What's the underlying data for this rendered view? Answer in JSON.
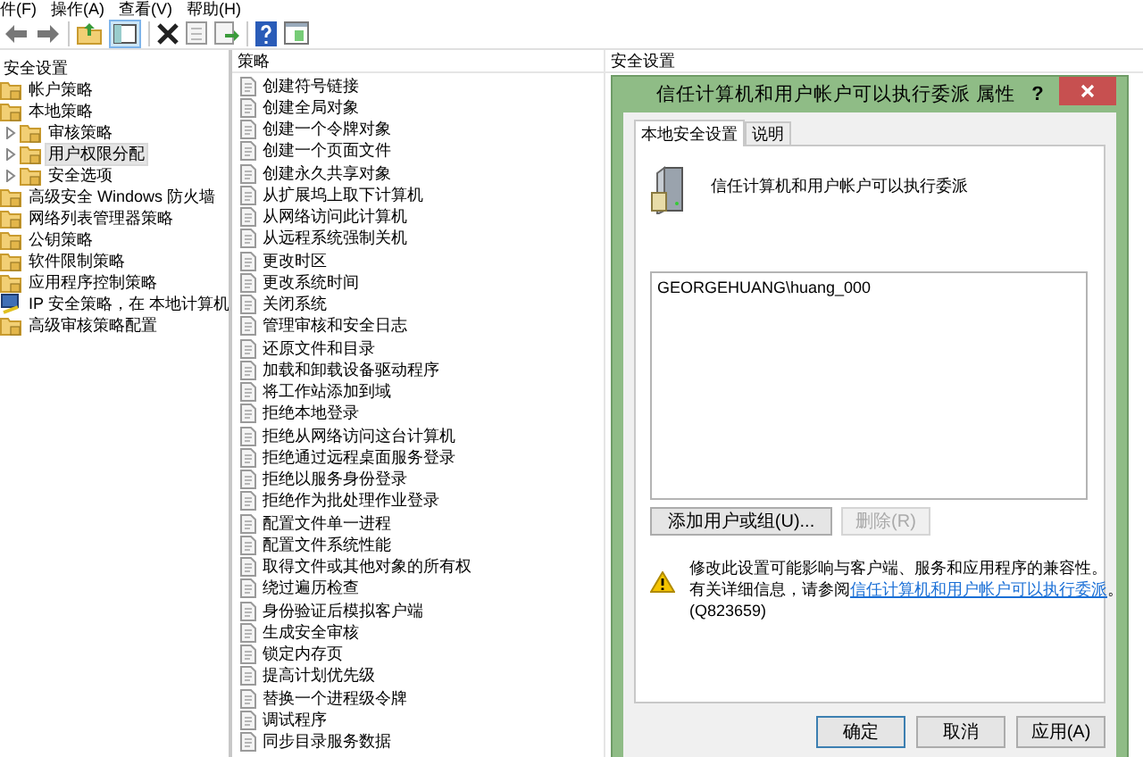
{
  "menu": [
    "件(F)",
    "操作(A)",
    "查看(V)",
    "帮助(H)"
  ],
  "tree": [
    {
      "label": "安全设置",
      "selected": false,
      "children": [
        {
          "label": "帐户策略",
          "kind": "folder",
          "selected": false
        },
        {
          "label": "本地策略",
          "kind": "folder",
          "selected": false,
          "children": [
            {
              "label": "审核策略",
              "kind": "folder",
              "selected": false,
              "expanded": false
            },
            {
              "label": "用户权限分配",
              "kind": "folder",
              "selected": true,
              "expanded": false
            },
            {
              "label": "安全选项",
              "kind": "folder",
              "selected": false,
              "expanded": false
            }
          ]
        },
        {
          "label": "高级安全 Windows 防火墙",
          "kind": "folder",
          "selected": false
        },
        {
          "label": "网络列表管理器策略",
          "kind": "folder",
          "selected": false
        },
        {
          "label": "公钥策略",
          "kind": "folder",
          "selected": false
        },
        {
          "label": "软件限制策略",
          "kind": "folder",
          "selected": false
        },
        {
          "label": "应用程序控制策略",
          "kind": "folder",
          "selected": false
        },
        {
          "label": "IP 安全策略，在 本地计算机",
          "kind": "ip-security",
          "selected": false
        },
        {
          "label": "高级审核策略配置",
          "kind": "folder",
          "selected": false
        }
      ]
    }
  ],
  "columns": [
    "策略",
    "安全设置"
  ],
  "policies": [
    "创建符号链接",
    "创建全局对象",
    "创建一个令牌对象",
    "创建一个页面文件",
    "创建永久共享对象",
    "从扩展坞上取下计算机",
    "从网络访问此计算机",
    "从远程系统强制关机",
    "更改时区",
    "更改系统时间",
    "关闭系统",
    "管理审核和安全日志",
    "还原文件和目录",
    "加载和卸载设备驱动程序",
    "将工作站添加到域",
    "拒绝本地登录",
    "拒绝从网络访问这台计算机",
    "拒绝通过远程桌面服务登录",
    "拒绝以服务身份登录",
    "拒绝作为批处理作业登录",
    "配置文件单一进程",
    "配置文件系统性能",
    "取得文件或其他对象的所有权",
    "绕过遍历检查",
    "身份验证后模拟客户端",
    "生成安全审核",
    "锁定内存页",
    "提高计划优先级",
    "替换一个进程级令牌",
    "调试程序",
    "同步目录服务数据"
  ],
  "dialog": {
    "title": "信任计算机和用户帐户可以执行委派 属性",
    "help": "?",
    "tabs": [
      {
        "label": "本地安全设置",
        "selected": true
      },
      {
        "label": "说明",
        "selected": false
      }
    ],
    "heading": "信任计算机和用户帐户可以执行委派",
    "accounts": [
      "GEORGEHUANG\\huang_000"
    ],
    "add_button": {
      "label": "添加用户或组(U)...",
      "disabled": false
    },
    "remove_button": {
      "label": "删除(R)",
      "disabled": true
    },
    "warning": {
      "line_1": "修改此设置可能影响与客户端、服务和应用程序的兼容性。",
      "line_2": "有关详细信息，请参阅",
      "link": "信任计算机和用户帐户可以执行委派",
      "line_2_end": "。",
      "line_3": "(Q823659)"
    },
    "buttons": [
      {
        "label": "确定",
        "default": true
      },
      {
        "label": "取消",
        "default": false
      },
      {
        "label": "应用(A)",
        "default": false
      }
    ]
  }
}
